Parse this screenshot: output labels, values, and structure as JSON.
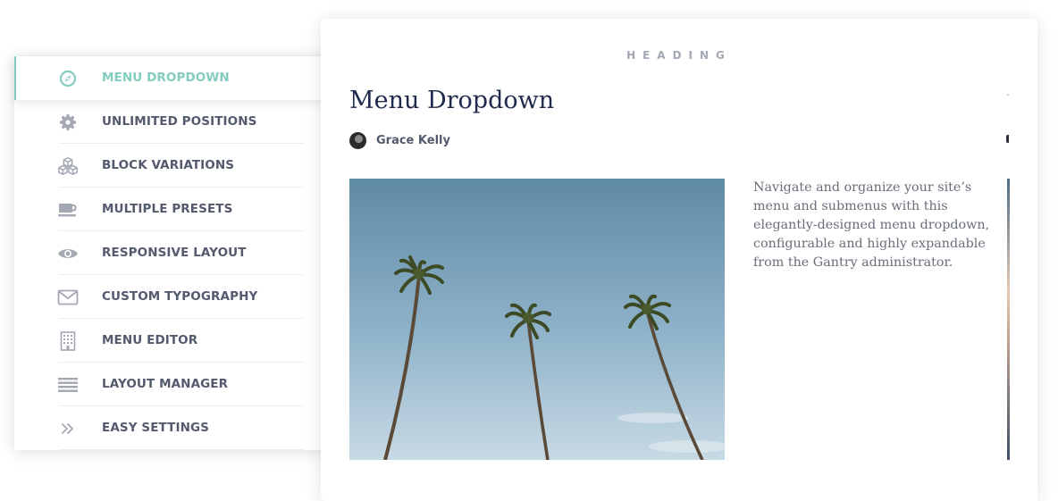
{
  "sidebar": {
    "items": [
      {
        "label": "MENU DROPDOWN",
        "icon": "compass-icon",
        "active": true
      },
      {
        "label": "UNLIMITED POSITIONS",
        "icon": "gear-icon",
        "active": false
      },
      {
        "label": "BLOCK VARIATIONS",
        "icon": "cubes-icon",
        "active": false
      },
      {
        "label": "MULTIPLE PRESETS",
        "icon": "coffee-cup-icon",
        "active": false
      },
      {
        "label": "RESPONSIVE LAYOUT",
        "icon": "eye-icon",
        "active": false
      },
      {
        "label": "CUSTOM TYPOGRAPHY",
        "icon": "envelope-icon",
        "active": false
      },
      {
        "label": "MENU EDITOR",
        "icon": "building-icon",
        "active": false
      },
      {
        "label": "LAYOUT MANAGER",
        "icon": "list-icon",
        "active": false
      },
      {
        "label": "EASY SETTINGS",
        "icon": "double-chevron-right-icon",
        "active": false
      }
    ]
  },
  "content": {
    "eyebrow": "HEADING",
    "article": {
      "title": "Menu Dropdown",
      "author": "Grace Kelly",
      "description": "Navigate and organize your site’s menu and submenus with this elegantly-designed menu dropdown, configurable and highly expandable from the Gantry administrator.",
      "image_subject": "palm-trees-photo"
    }
  },
  "colors": {
    "accent": "#82cdbf",
    "menu_text": "#545a6e",
    "icon": "#a4a8b3",
    "heading_muted": "#a3a8b4",
    "title": "#1f2a4c",
    "body_text": "#6a6e7a"
  }
}
